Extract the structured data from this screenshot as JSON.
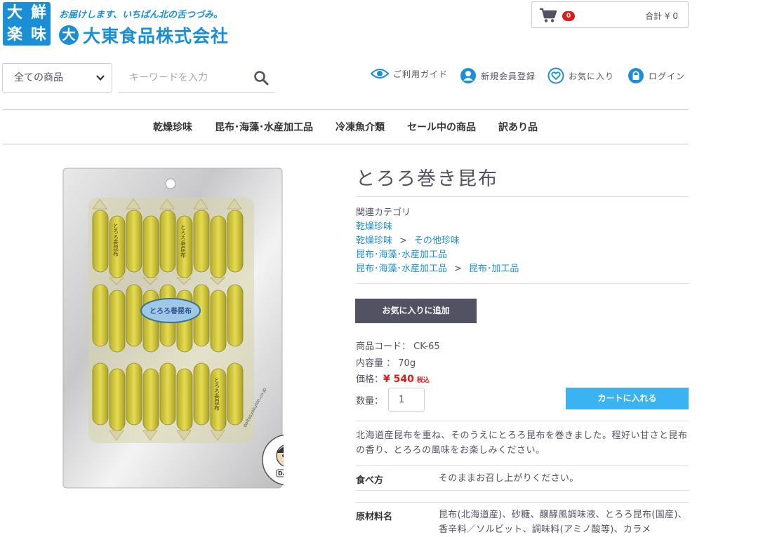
{
  "header": {
    "logo_chars": [
      "大",
      "鮮",
      "楽",
      "味"
    ],
    "tagline": "お届けします、いちばん北の舌つづみ。",
    "company_mark": "大",
    "company_name": "大東食品株式会社",
    "cart": {
      "count": "0",
      "total": "合計 ¥ 0"
    }
  },
  "search": {
    "category": "全ての商品",
    "placeholder": "キーワードを入力"
  },
  "util_nav": {
    "guide": "ご利用ガイド",
    "register": "新規会員登録",
    "favorites": "お気に入り",
    "login": "ログイン"
  },
  "gnav": [
    "乾燥珍味",
    "昆布･海藻･水産加工品",
    "冷凍魚介類",
    "セール中の商品",
    "訳あり品"
  ],
  "product": {
    "title": "とろろ巻き昆布",
    "related_label": "関連カテゴリ",
    "categories": [
      {
        "parts": [
          "乾燥珍味"
        ]
      },
      {
        "parts": [
          "乾燥珍味",
          "その他珍味"
        ]
      },
      {
        "parts": [
          "昆布･海藻･水産加工品"
        ]
      },
      {
        "parts": [
          "昆布･海藻･水産加工品",
          "昆布･加工品"
        ]
      }
    ],
    "breadcrumb_sep": ">",
    "fav_button": "お気に入りに追加",
    "code_label": "商品コード：",
    "code": "CK-65",
    "volume_label": "内容量 ：",
    "volume": "70g",
    "price_label": "価格：",
    "price": "¥ 540",
    "tax_label": "税込",
    "qty_label": "数量：",
    "qty": "1",
    "cart_button": "カートに入れる",
    "description": "北海道産昆布を重ね、そのうえにとろろ昆布を巻きました。程好い甘さと昆布の香り、とろろの風味をお楽しみください。",
    "eat_label": "食べ方",
    "eat_value": "そのままお召し上がりください。",
    "ingredients_label": "原材料名",
    "ingredients_value": "昆布(北海道産)、砂糖、醸酵風調味液、とろろ昆布(国産)、香辛料／ソルビット、調味料(アミノ酸等)、カラメ",
    "image_labels": {
      "center_label": "とろろ巻昆布",
      "candy_text": "とろろ巻昆布",
      "mascot": "DAITO",
      "url_text": "daitosyokuhin.co.jp"
    }
  },
  "colors": {
    "brand_blue": "#1a8fd6",
    "cart_blue": "#3bb2f2",
    "dark_button": "#525263",
    "price_red": "#de1a1a"
  }
}
